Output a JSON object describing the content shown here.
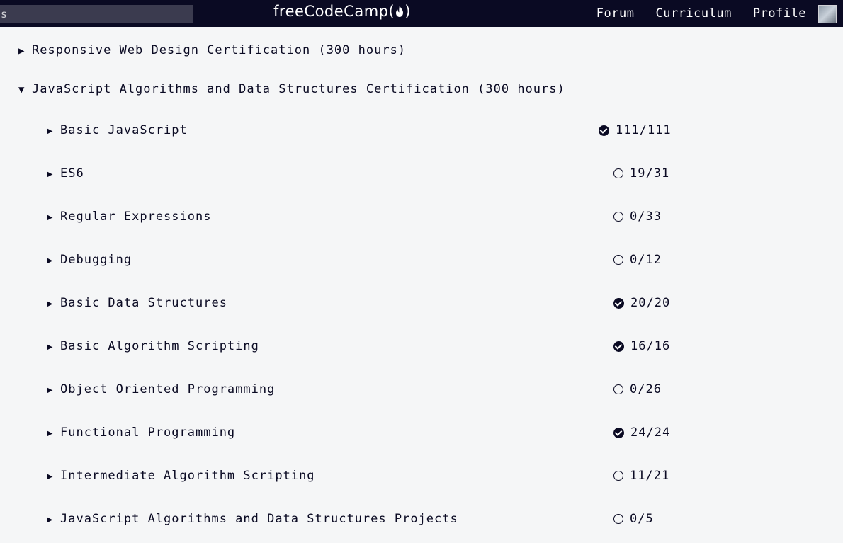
{
  "nav": {
    "search_value": "ls",
    "logo_text": "freeCodeCamp(",
    "logo_close": ")",
    "links": [
      "Forum",
      "Curriculum",
      "Profile"
    ]
  },
  "certifications": [
    {
      "title": "Responsive Web Design Certification (300 hours)",
      "expanded": false
    },
    {
      "title": "JavaScript Algorithms and Data Structures Certification (300 hours)",
      "expanded": true
    }
  ],
  "blocks": [
    {
      "title": "Basic JavaScript",
      "progress": "111/111",
      "complete": true
    },
    {
      "title": "ES6",
      "progress": "19/31",
      "complete": false
    },
    {
      "title": "Regular Expressions",
      "progress": "0/33",
      "complete": false
    },
    {
      "title": "Debugging",
      "progress": "0/12",
      "complete": false
    },
    {
      "title": "Basic Data Structures",
      "progress": "20/20",
      "complete": true
    },
    {
      "title": "Basic Algorithm Scripting",
      "progress": "16/16",
      "complete": true
    },
    {
      "title": "Object Oriented Programming",
      "progress": "0/26",
      "complete": false
    },
    {
      "title": "Functional Programming",
      "progress": "24/24",
      "complete": true
    },
    {
      "title": "Intermediate Algorithm Scripting",
      "progress": "11/21",
      "complete": false
    },
    {
      "title": "JavaScript Algorithms and Data Structures Projects",
      "progress": "0/5",
      "complete": false
    }
  ],
  "icons": {
    "collapsed": "caret-right-icon",
    "expanded": "caret-down-icon",
    "complete": "check-circle-icon",
    "incomplete": "empty-circle-icon",
    "logo": "flame-icon"
  },
  "colors": {
    "nav_bg": "#0a0a23",
    "page_bg": "#f5f6f7",
    "text": "#0a0a23",
    "search_bg": "#3b3b4f"
  }
}
